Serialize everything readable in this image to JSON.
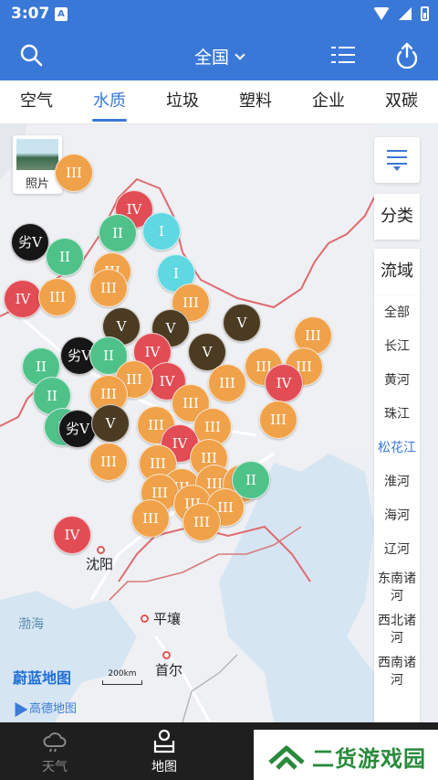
{
  "status_bar": {
    "time": "3:07",
    "notif": "A"
  },
  "header": {
    "region": "全国"
  },
  "tabs": [
    {
      "label": "空气",
      "active": false
    },
    {
      "label": "水质",
      "active": true
    },
    {
      "label": "垃圾",
      "active": false
    },
    {
      "label": "塑料",
      "active": false
    },
    {
      "label": "企业",
      "active": false
    },
    {
      "label": "双碳",
      "active": false
    }
  ],
  "map": {
    "photo_label": "照片",
    "cities": {
      "shenyang": "沈阳",
      "pyongyang": "平壤",
      "seoul": "首尔"
    },
    "sea": "渤海",
    "brand": "蔚蓝地图",
    "scale": "200km",
    "gaode": "高德地图",
    "marker_colors": {
      "I": "#5fd8e2",
      "II": "#4fc28a",
      "III": "#f0a24a",
      "IV": "#e24c55",
      "V": "#4a3b22",
      "劣V": "#161616"
    },
    "markers": [
      {
        "grade": "III",
        "label": "III"
      },
      {
        "grade": "IV",
        "label": "IV"
      },
      {
        "grade": "I",
        "label": "I"
      },
      {
        "grade": "劣V",
        "label": "劣V"
      },
      {
        "grade": "II",
        "label": "II"
      },
      {
        "grade": "II",
        "label": "II"
      },
      {
        "grade": "III",
        "label": "III"
      },
      {
        "grade": "IV",
        "label": "IV"
      },
      {
        "grade": "III",
        "label": "III"
      },
      {
        "grade": "I",
        "label": "I"
      },
      {
        "grade": "III",
        "label": "III"
      },
      {
        "grade": "III",
        "label": "III"
      },
      {
        "grade": "V",
        "label": "V"
      },
      {
        "grade": "V",
        "label": "V"
      },
      {
        "grade": "V",
        "label": "V"
      },
      {
        "grade": "III",
        "label": "III"
      },
      {
        "grade": "II",
        "label": "II"
      },
      {
        "grade": "劣V",
        "label": "劣V"
      },
      {
        "grade": "II",
        "label": "II"
      },
      {
        "grade": "IV",
        "label": "IV"
      },
      {
        "grade": "V",
        "label": "V"
      },
      {
        "grade": "III",
        "label": "III"
      },
      {
        "grade": "III",
        "label": "III"
      },
      {
        "grade": "IV",
        "label": "IV"
      },
      {
        "grade": "III",
        "label": "III"
      },
      {
        "grade": "III",
        "label": "III"
      },
      {
        "grade": "IV",
        "label": "IV"
      },
      {
        "grade": "II",
        "label": "II"
      },
      {
        "grade": "III",
        "label": "III"
      },
      {
        "grade": "III",
        "label": "III"
      },
      {
        "grade": "II",
        "label": "II"
      },
      {
        "grade": "III",
        "label": "III"
      },
      {
        "grade": "劣V",
        "label": "劣V"
      },
      {
        "grade": "V",
        "label": "V"
      },
      {
        "grade": "III",
        "label": "III"
      },
      {
        "grade": "III",
        "label": "III"
      },
      {
        "grade": "IV",
        "label": "IV"
      },
      {
        "grade": "III",
        "label": "III"
      },
      {
        "grade": "III",
        "label": "III"
      },
      {
        "grade": "III",
        "label": "III"
      },
      {
        "grade": "III",
        "label": "III"
      },
      {
        "grade": "III",
        "label": "III"
      },
      {
        "grade": "III",
        "label": "III"
      },
      {
        "grade": "II",
        "label": "II"
      },
      {
        "grade": "III",
        "label": "III"
      },
      {
        "grade": "III",
        "label": "III"
      },
      {
        "grade": "III",
        "label": "III"
      },
      {
        "grade": "III",
        "label": "III"
      },
      {
        "grade": "III",
        "label": "III"
      },
      {
        "grade": "IV",
        "label": "IV"
      }
    ]
  },
  "panel": {
    "category": "分类",
    "basin": "流域",
    "basins": [
      {
        "label": "全部",
        "active": false
      },
      {
        "label": "长江",
        "active": false
      },
      {
        "label": "黄河",
        "active": false
      },
      {
        "label": "珠江",
        "active": false
      },
      {
        "label": "松花江",
        "active": true
      },
      {
        "label": "淮河",
        "active": false
      },
      {
        "label": "海河",
        "active": false
      },
      {
        "label": "辽河",
        "active": false
      },
      {
        "label": "东南诸河",
        "active": false
      },
      {
        "label": "西北诸河",
        "active": false
      },
      {
        "label": "西南诸河",
        "active": false
      }
    ]
  },
  "bottom_nav": [
    {
      "label": "天气",
      "icon": "cloud-icon",
      "active": false
    },
    {
      "label": "地图",
      "icon": "map-pin-icon",
      "active": true
    }
  ],
  "watermark": {
    "text": "二货游戏园"
  }
}
